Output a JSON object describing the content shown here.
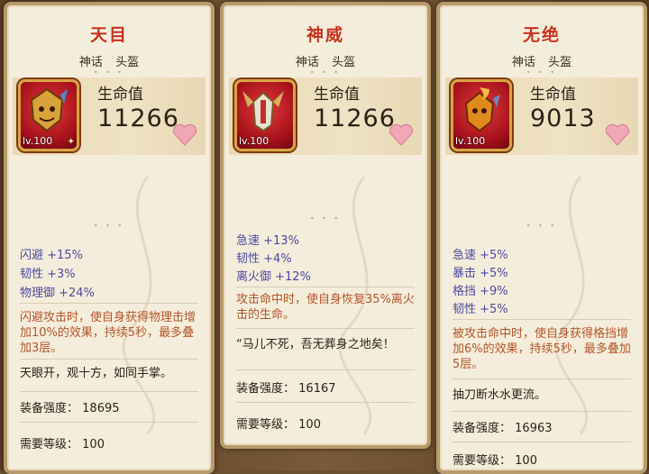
{
  "cards": [
    {
      "title": "天目",
      "rarity": "神话",
      "slot": "头盔",
      "level": "lv.100",
      "stat_label": "生命值",
      "stat_value": "11266",
      "attrs": [
        "闪避 +15%",
        "韧性 +3%",
        "物理御 +24%"
      ],
      "effect": "闪避攻击时，使自身获得物理击增加10%的效果，持续5秒，最多叠加3层。",
      "flavor": "天眼开，观十方，如同手掌。",
      "power_label": "装备强度：",
      "power": "18695",
      "req_label": "需要等级：",
      "req": "100",
      "icon": "golden-lion-helmet-icon"
    },
    {
      "title": "神威",
      "rarity": "神话",
      "slot": "头盔",
      "level": "lv.100",
      "stat_label": "生命值",
      "stat_value": "11266",
      "attrs": [
        "急速 +13%",
        "韧性 +4%",
        "离火御 +12%"
      ],
      "effect": "攻击命中时，使自身恢复35%离火击的生命。",
      "flavor": "“马儿不死，吾无葬身之地矣！",
      "power_label": "装备强度：",
      "power": "16167",
      "req_label": "需要等级：",
      "req": "100",
      "icon": "winged-silver-helmet-icon"
    },
    {
      "title": "无绝",
      "rarity": "神话",
      "slot": "头盔",
      "level": "lv.100",
      "stat_label": "生命值",
      "stat_value": "9013",
      "attrs": [
        "急速 +5%",
        "暴击 +5%",
        "格挡 +9%",
        "韧性 +5%"
      ],
      "effect": "被攻击命中时，使自身获得格挡增加6%的效果，持续5秒，最多叠加5层。",
      "flavor": "抽刀断水水更流。",
      "power_label": "装备强度：",
      "power": "16963",
      "req_label": "需要等级：",
      "req": "100",
      "icon": "flame-gold-helmet-icon"
    }
  ],
  "colors": {
    "title": "#c8321a",
    "attr": "#4a4aa0",
    "effect": "#b4542c",
    "panel": "#f5eddb",
    "frame": "#b89a6c"
  }
}
